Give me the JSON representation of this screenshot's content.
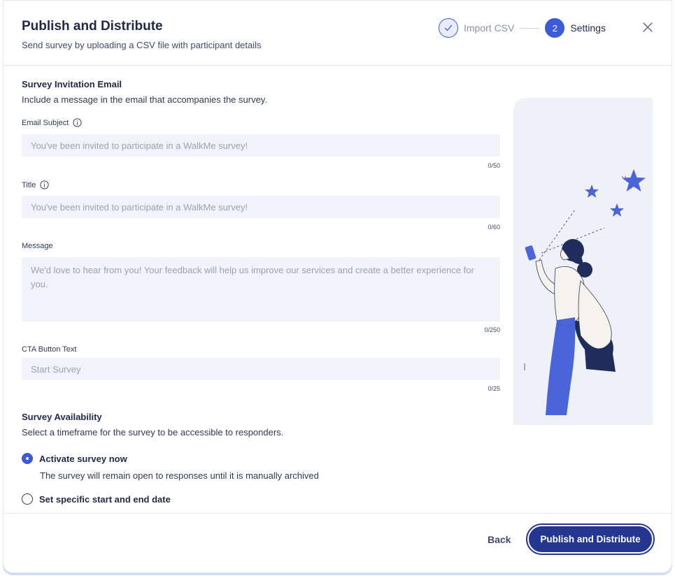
{
  "header": {
    "title": "Publish and Distribute",
    "subtitle": "Send survey by uploading a CSV file with participant details"
  },
  "stepper": {
    "steps": [
      {
        "label": "Import CSV",
        "state": "done",
        "icon": "check-icon"
      },
      {
        "label": "Settings",
        "state": "active",
        "number": "2"
      }
    ]
  },
  "email_section": {
    "title": "Survey Invitation Email",
    "description": "Include a message in the email that accompanies the survey."
  },
  "fields": {
    "email_subject": {
      "label": "Email Subject",
      "placeholder": "You've been invited to participate in a WalkMe survey!",
      "counter": "0/50"
    },
    "title": {
      "label": "Title",
      "placeholder": "You've been invited to participate in a WalkMe survey!",
      "counter": "0/60"
    },
    "message": {
      "label": "Message",
      "placeholder": "We'd love to hear from you! Your feedback will help us improve our services and create a better experience for you.",
      "counter": "0/250"
    },
    "cta": {
      "label": "CTA Button Text",
      "placeholder": "Start Survey",
      "counter": "0/25"
    }
  },
  "availability": {
    "title": "Survey Availability",
    "description": "Select a timeframe for the survey to be accessible to responders.",
    "options": [
      {
        "label": "Activate survey now",
        "help": "The survey will remain open to responses until it is manually archived",
        "checked": true
      },
      {
        "label": "Set specific start and end date",
        "checked": false
      }
    ]
  },
  "footer": {
    "back_label": "Back",
    "primary_label": "Publish and Distribute"
  },
  "colors": {
    "accent": "#3d5ad8",
    "primary_button": "#24368f",
    "input_background": "#f0f3f9"
  }
}
